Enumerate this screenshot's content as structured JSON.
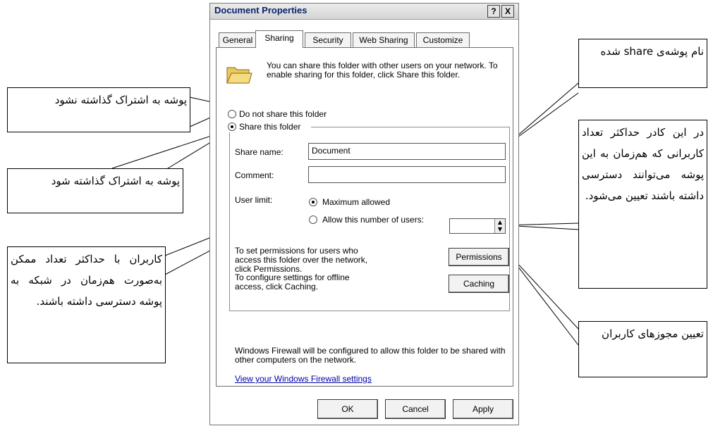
{
  "dialog": {
    "title": "Document Properties",
    "help_btn": "?",
    "close_btn": "X",
    "tabs": [
      {
        "label": "General"
      },
      {
        "label": "Sharing"
      },
      {
        "label": "Security"
      },
      {
        "label": "Web Sharing"
      },
      {
        "label": "Customize"
      }
    ],
    "intro_text": "You can share this folder with other users on your network. To enable sharing for this folder, click Share this folder.",
    "radio_do_not_share": "Do not share this folder",
    "radio_share": "Share this folder",
    "share_name_label": "Share name:",
    "share_name_value": "Document",
    "comment_label": "Comment:",
    "comment_value": "",
    "user_limit_label": "User limit:",
    "radio_max_allowed": "Maximum allowed",
    "radio_allow_number": "Allow this number of users:",
    "permissions_text": "To set permissions for users who access this folder over the network, click Permissions.",
    "permissions_button": "Permissions",
    "caching_text": "To configure settings for offline access, click Caching.",
    "caching_button": "Caching",
    "firewall_text": "Windows Firewall will be configured to allow this folder to be shared with other computers on the network.",
    "firewall_link": "View your Windows Firewall settings",
    "ok_button": "OK",
    "cancel_button": "Cancel",
    "apply_button": "Apply"
  },
  "callouts": {
    "share_name": "نام پوشه‌ی share شده",
    "not_shared": "پوشه به اشتراک گذاشته نشود",
    "shared": "پوشه به اشتراک گذاشته شود",
    "user_count": "در این کادر حداکثر تعداد کاربرانی که هم‌زمان به این پوشه می‌توانند دسترسی داشته باشند تعیین می‌شود.",
    "max_users": "کاربران با حداکثر تعداد ممکن به‌صورت هم‌زمان در شبکه به پوشه دسترسی داشته باشند.",
    "permissions": "تعیین مجوزهای کاربران"
  }
}
